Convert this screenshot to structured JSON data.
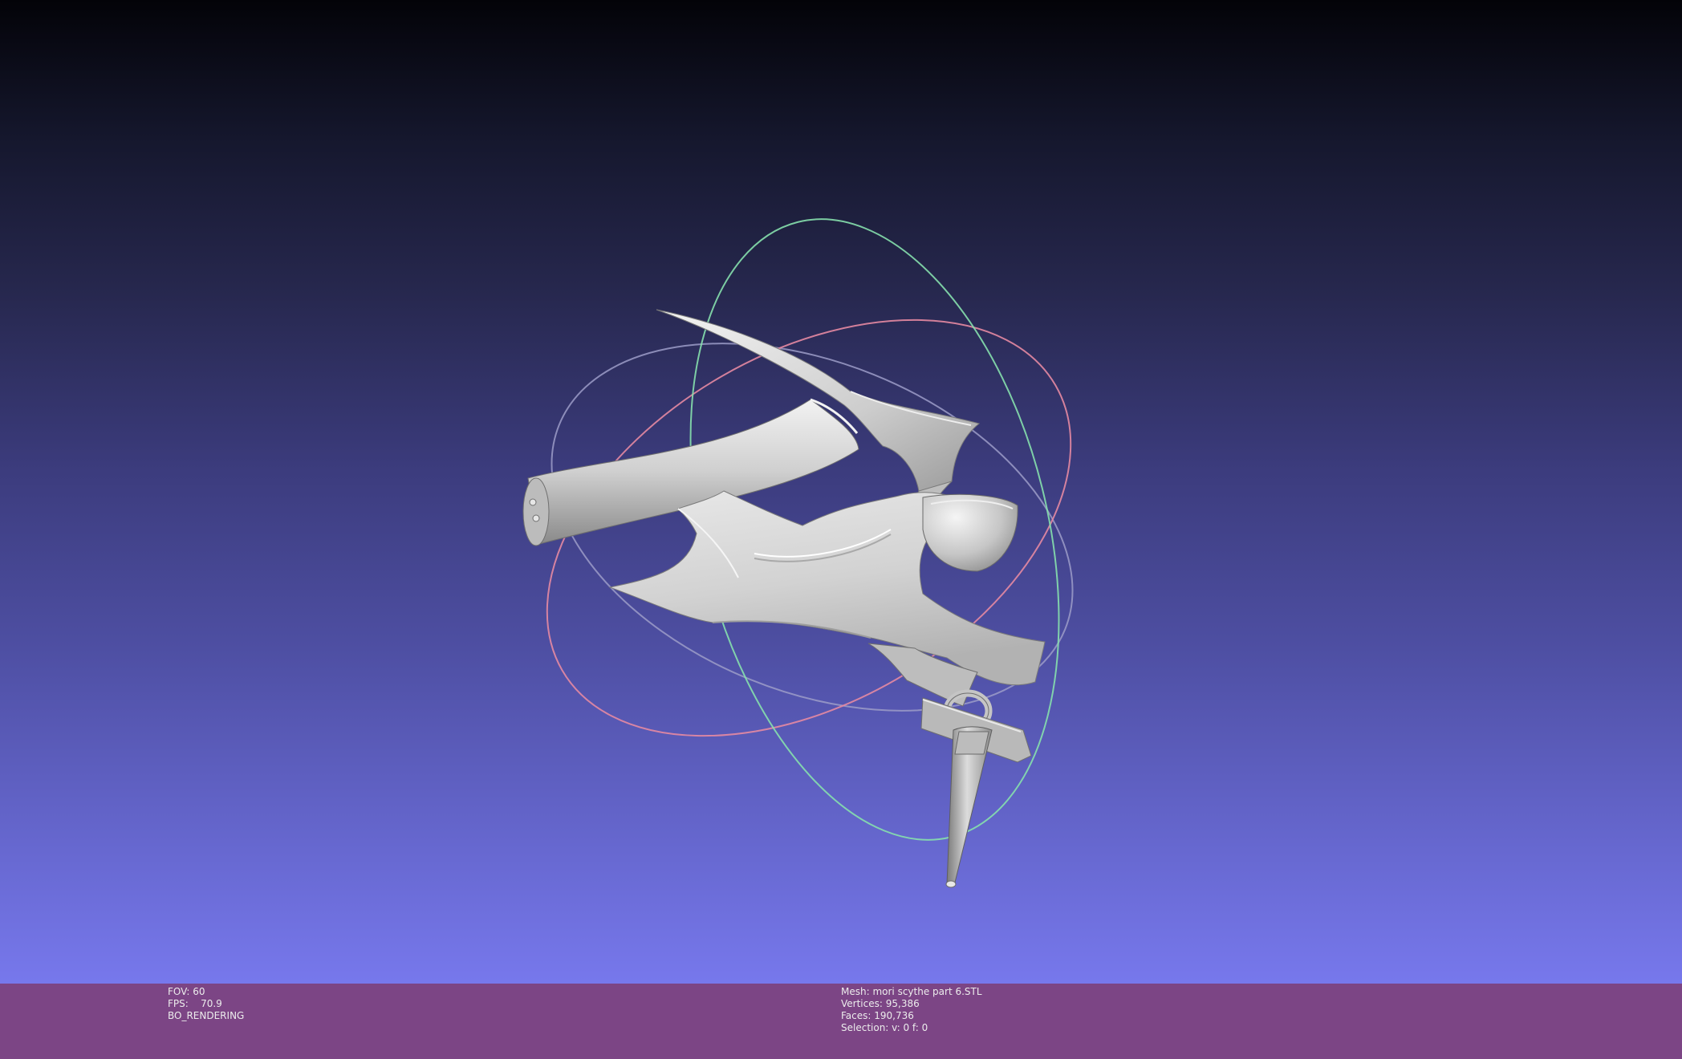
{
  "viewer": {
    "background_top": "#030308",
    "background_bottom": "#7778ec",
    "model_color": "#d6d6d6",
    "trackball_colors": [
      "#e58aa2",
      "#86e0ad",
      "#9c9cc8"
    ],
    "model_name": "mori scythe part 6"
  },
  "status_left": {
    "fov_label": "FOV:",
    "fov_value": "60",
    "fps_label": "FPS:",
    "fps_value": "70.9",
    "render_mode": "BO_RENDERING"
  },
  "status_right": {
    "mesh_label": "Mesh:",
    "mesh_value": "mori scythe part 6.STL",
    "vertices_label": "Vertices:",
    "vertices_value": "95,386",
    "faces_label": "Faces:",
    "faces_value": "190,736",
    "selection_label": "Selection:",
    "selection_value": "v: 0 f: 0"
  }
}
